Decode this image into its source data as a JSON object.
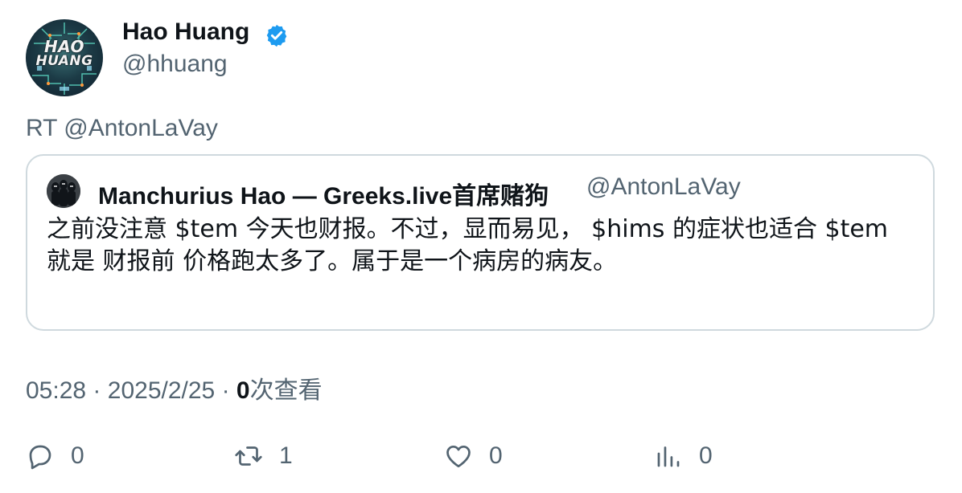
{
  "author": {
    "name": "Hao Huang",
    "handle": "@hhuang",
    "avatar_text_line1": "HAO",
    "avatar_text_line2": "HUANG",
    "verified": true
  },
  "retweet_label": "RT @AntonLaVay",
  "quote": {
    "name": "Manchurius Hao — Greeks.live首席赌狗",
    "handle": "@AntonLaVay",
    "text_line1": "之前没注意 $tem 今天也财报。不过，显而易见， $hims 的症状也适合 $tem",
    "text_line2": "就是 财报前 价格跑太多了。属于是一个病房的病友。"
  },
  "meta": {
    "time": "05:28",
    "separator": "·",
    "date": "2025/2/25",
    "views_count": "0",
    "views_label": "次查看"
  },
  "actions": {
    "reply_count": "0",
    "retweet_count": "1",
    "like_count": "0",
    "views_count": "0"
  },
  "colors": {
    "verified": "#1d9bf0",
    "text_primary": "#0f1419",
    "text_secondary": "#536471",
    "border": "#cfd9de"
  }
}
